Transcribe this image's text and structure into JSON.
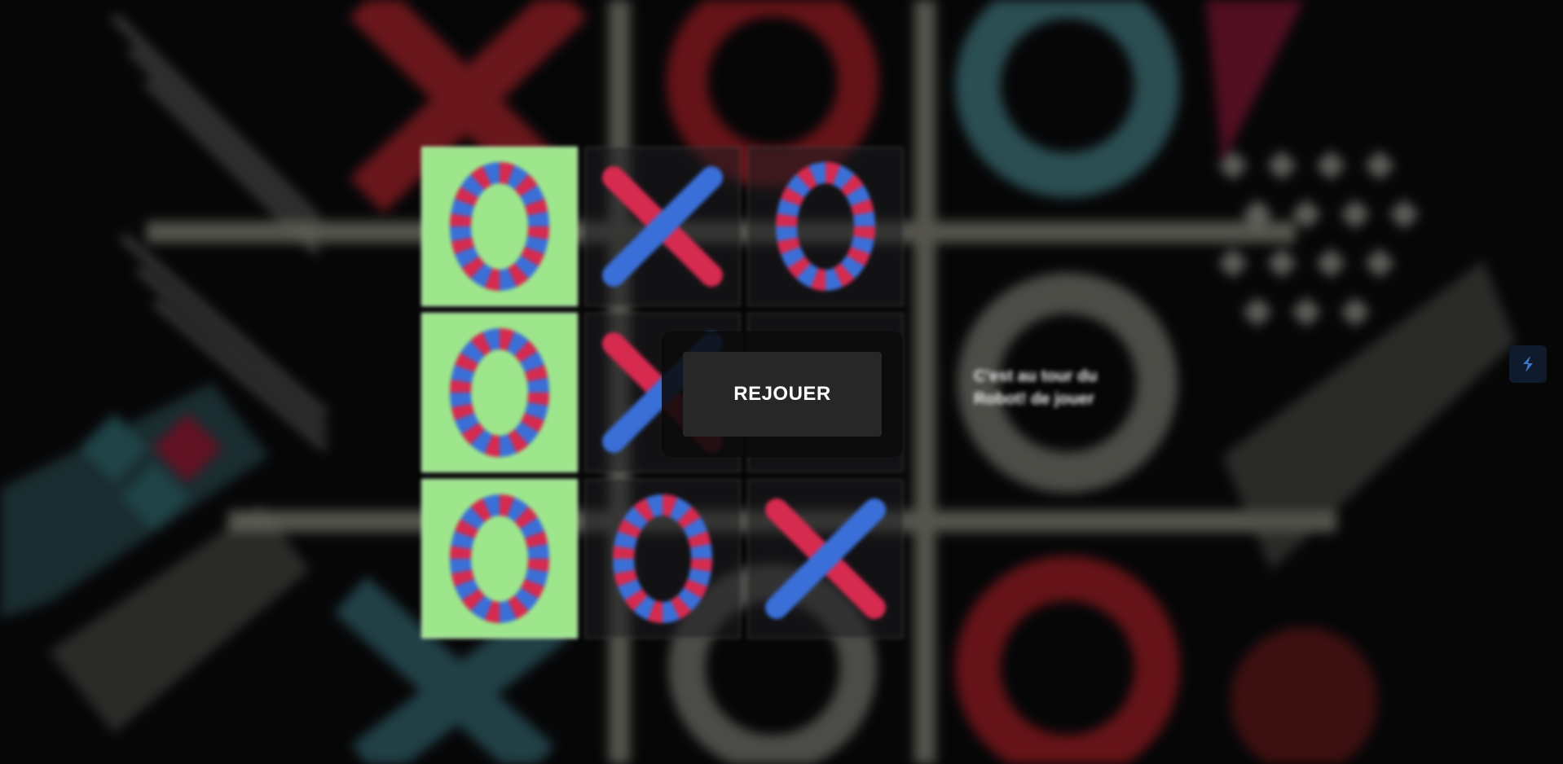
{
  "board": {
    "cells": [
      {
        "mark": "O",
        "win": true
      },
      {
        "mark": "X",
        "win": false
      },
      {
        "mark": "O",
        "win": false
      },
      {
        "mark": "O",
        "win": true
      },
      {
        "mark": "X",
        "win": false
      },
      {
        "mark": "",
        "win": false
      },
      {
        "mark": "O",
        "win": true
      },
      {
        "mark": "O",
        "win": false
      },
      {
        "mark": "X",
        "win": false
      }
    ]
  },
  "status": {
    "message": "C'est au tour du Robot! de jouer"
  },
  "replay": {
    "label": "REJOUER"
  },
  "colors": {
    "win": "#9ee68c",
    "button": "#272727",
    "mark_red": "#d62a4f",
    "mark_blue": "#3a6fd8"
  },
  "icons": {
    "side": "extension-icon"
  }
}
